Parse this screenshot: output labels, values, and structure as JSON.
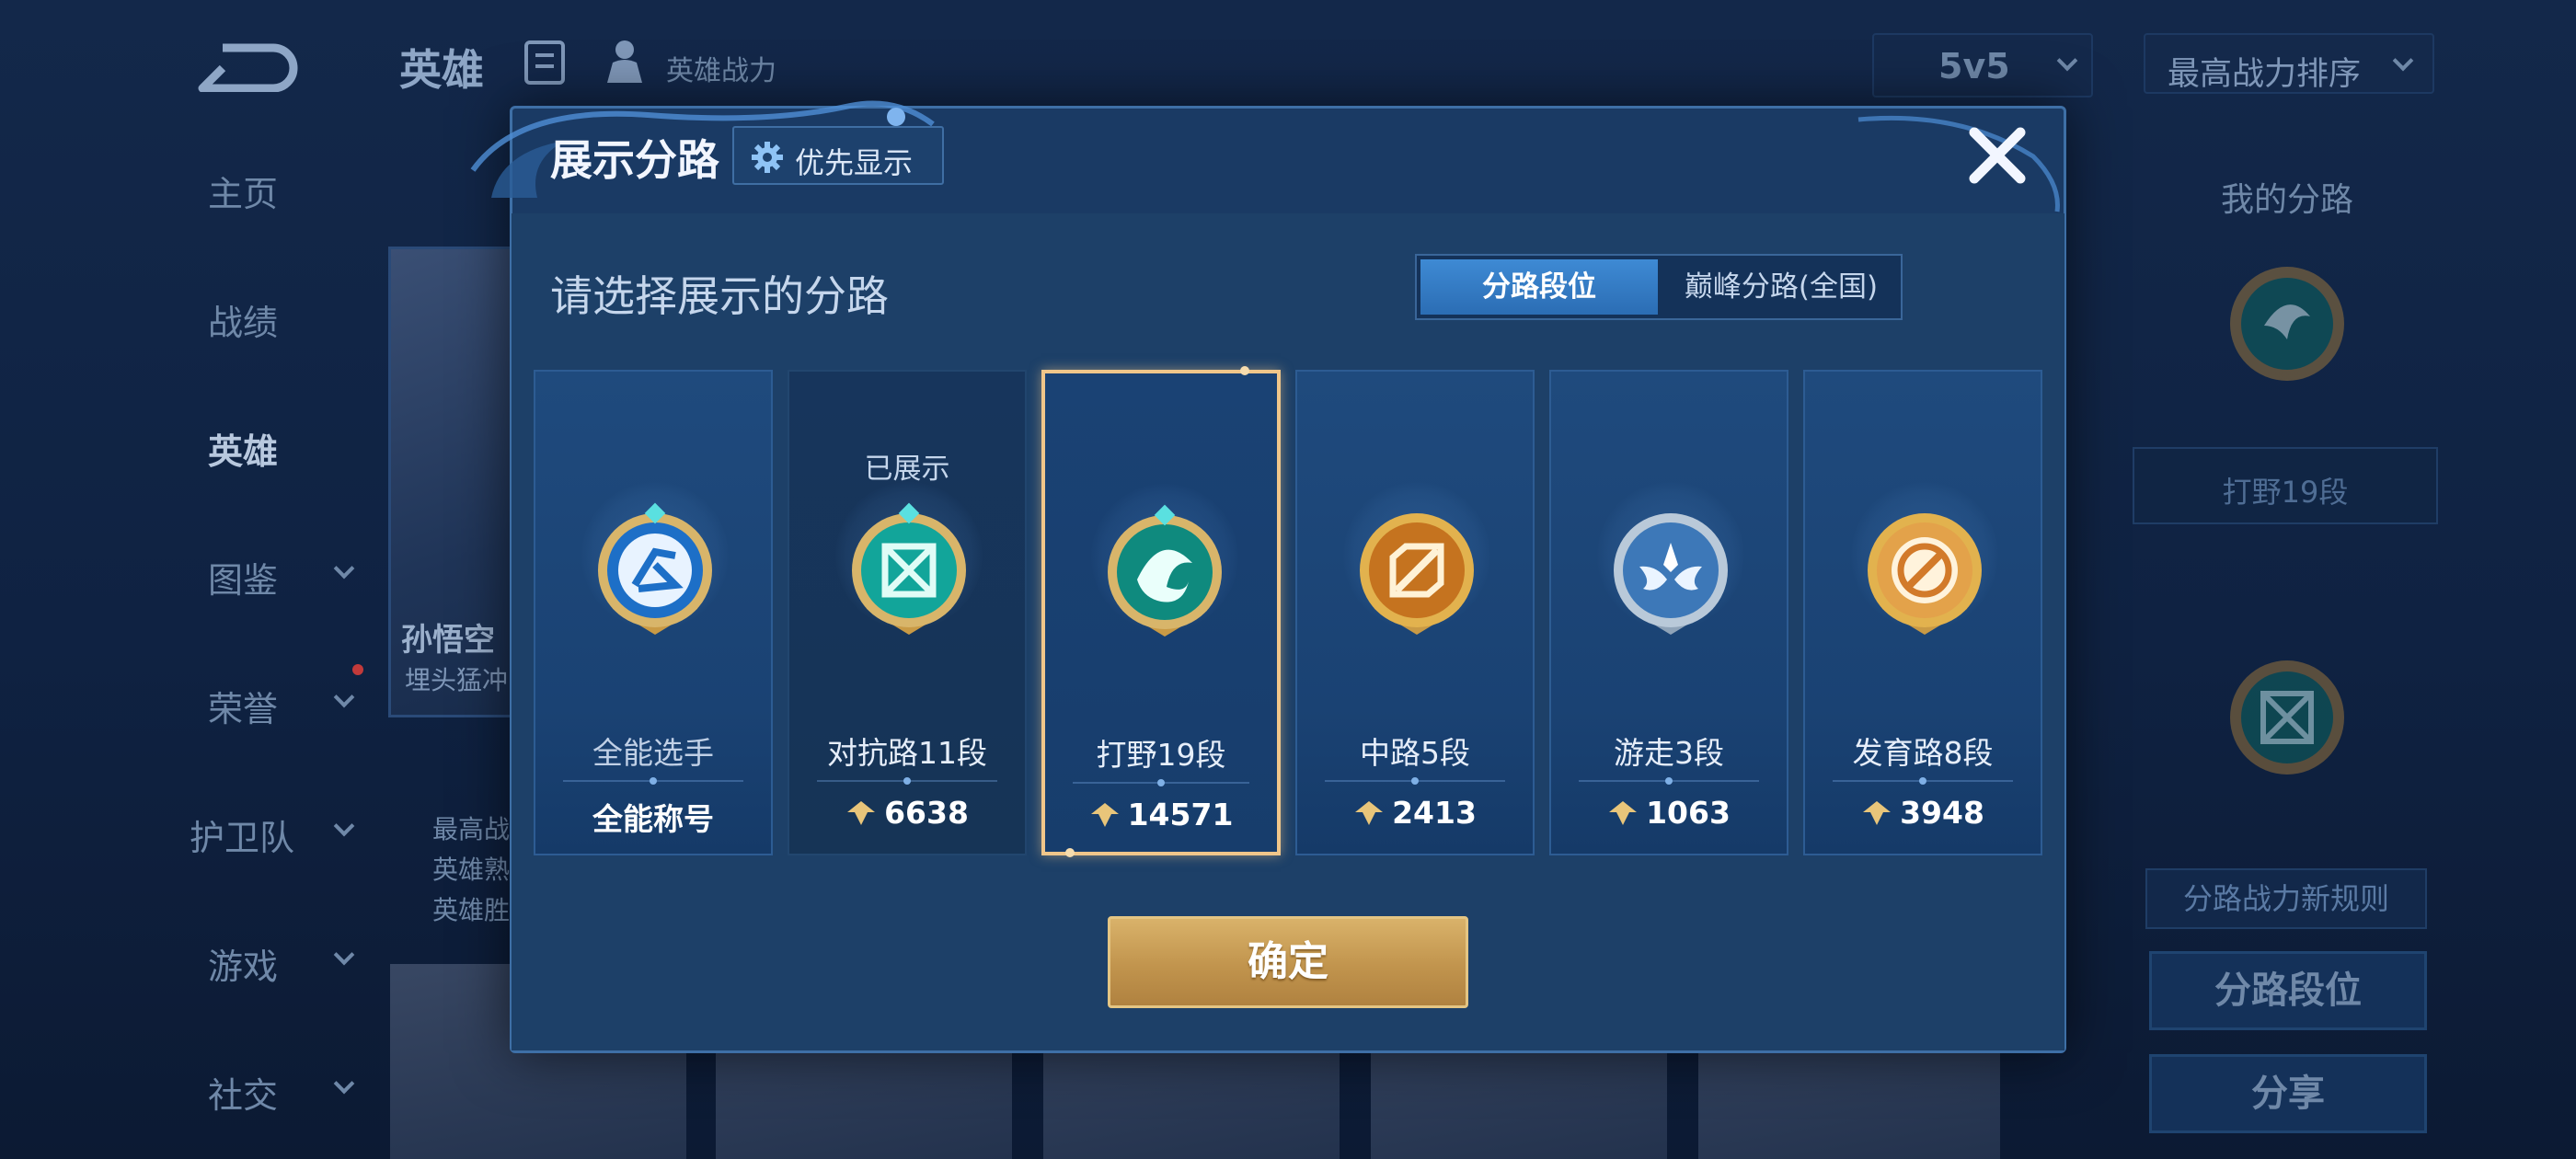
{
  "background": {
    "header": {
      "title": "英雄",
      "subtitle": "英雄战力"
    },
    "mode_select": {
      "value": "5v5"
    },
    "sort_select": {
      "value": "最高战力排序"
    },
    "nav": [
      {
        "label": "主页",
        "has_arrow": false
      },
      {
        "label": "战绩",
        "has_arrow": false
      },
      {
        "label": "英雄",
        "has_arrow": false,
        "active": true
      },
      {
        "label": "图鉴",
        "has_arrow": true
      },
      {
        "label": "荣誉",
        "has_arrow": true
      },
      {
        "label": "护卫队",
        "has_arrow": true
      },
      {
        "label": "游戏",
        "has_arrow": true
      },
      {
        "label": "社交",
        "has_arrow": true
      }
    ],
    "hero_card": {
      "name": "孙悟空",
      "subtitle": "埋头猛冲",
      "stats": [
        "最高战",
        "英雄熟",
        "英雄胜"
      ]
    },
    "right_panel": {
      "title": "我的分路",
      "lane_label": "打野19段",
      "rule_label": "分路战力新规则",
      "button_1": "分路段位",
      "button_2": "分享"
    }
  },
  "modal": {
    "title": "展示分路",
    "priority_button": "优先显示",
    "prompt": "请选择展示的分路",
    "tabs": [
      {
        "label": "分路段位",
        "active": true
      },
      {
        "label": "巅峰分路(全国)",
        "active": false
      }
    ],
    "lanes": [
      {
        "name": "全能选手",
        "score": "全能称号",
        "show_power_icon": false,
        "shown_label": "",
        "selected": false,
        "emblem": "allround-emblem-icon"
      },
      {
        "name": "对抗路11段",
        "score": "6638",
        "show_power_icon": true,
        "shown_label": "已展示",
        "selected": false,
        "emblem": "clash-lane-emblem-icon"
      },
      {
        "name": "打野19段",
        "score": "14571",
        "show_power_icon": true,
        "shown_label": "",
        "selected": true,
        "emblem": "jungle-emblem-icon"
      },
      {
        "name": "中路5段",
        "score": "2413",
        "show_power_icon": true,
        "shown_label": "",
        "selected": false,
        "emblem": "mid-lane-emblem-icon"
      },
      {
        "name": "游走3段",
        "score": "1063",
        "show_power_icon": true,
        "shown_label": "",
        "selected": false,
        "emblem": "roam-emblem-icon"
      },
      {
        "name": "发育路8段",
        "score": "3948",
        "show_power_icon": true,
        "shown_label": "",
        "selected": false,
        "emblem": "farm-lane-emblem-icon"
      }
    ],
    "confirm_button": "确定"
  },
  "colors": {
    "modal_bg": "#1a3a64",
    "tab_active": "#3e8ad4",
    "selected_border": "#f0c68a",
    "confirm_gold": "#c89b55",
    "power_icon": "#e8c57a"
  }
}
